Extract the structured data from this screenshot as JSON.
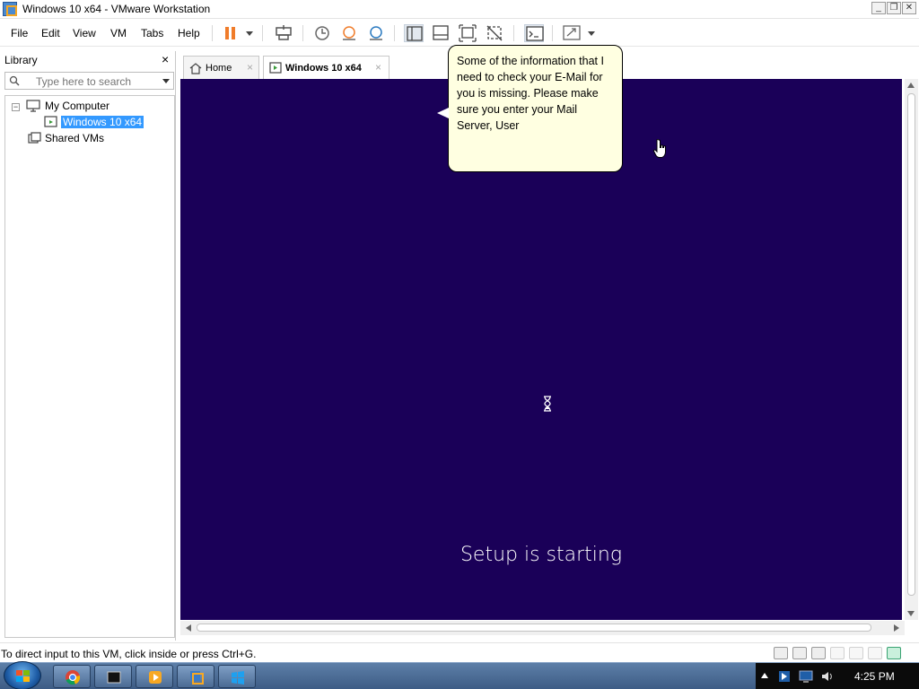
{
  "window": {
    "title": "Windows 10 x64 - VMware Workstation"
  },
  "menu": {
    "file": "File",
    "edit": "Edit",
    "view": "View",
    "vm": "VM",
    "tabs": "Tabs",
    "help": "Help"
  },
  "library": {
    "title": "Library",
    "close": "×",
    "search_placeholder": "Type here to search",
    "tree": {
      "my_computer": "My Computer",
      "vm": "Windows 10 x64",
      "shared": "Shared VMs"
    }
  },
  "tabs": [
    {
      "label": "Home",
      "close": "×"
    },
    {
      "label": "Windows 10 x64",
      "close": "×"
    }
  ],
  "tooltip": {
    "text": "Some of the information that I need to check your E-Mail for you is missing. Please make sure you enter your Mail Server, User"
  },
  "vm_screen": {
    "status": "Setup is starting",
    "background": "#1a0058"
  },
  "statusbar": {
    "text": "To direct input to this VM, click inside or press Ctrl+G."
  },
  "taskbar": {
    "clock": "4:25 PM"
  },
  "icons": {
    "toolbar": [
      "pause-icon",
      "send-ctrl-alt-del-icon",
      "snapshot-icon",
      "revert-snapshot-icon",
      "manage-snapshots-icon",
      "show-library-icon",
      "thumbnail-bar-icon",
      "full-screen-icon",
      "unity-icon",
      "console-view-icon",
      "stretch-guest-icon"
    ],
    "taskbar": [
      "start-orb-icon",
      "chrome-icon",
      "terminal-icon",
      "media-player-icon",
      "vmware-icon",
      "windows-icon"
    ]
  }
}
